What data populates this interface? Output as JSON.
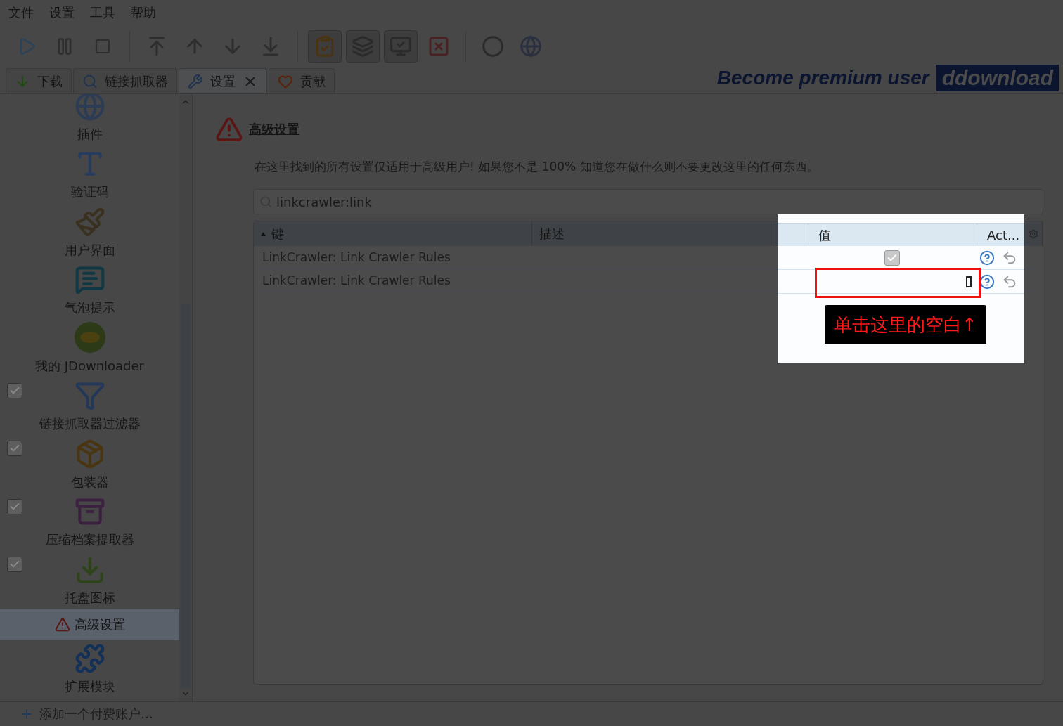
{
  "menu": [
    "文件",
    "设置",
    "工具",
    "帮助"
  ],
  "tabs": [
    {
      "label": "下载",
      "selected": false,
      "closable": false,
      "kind": "download"
    },
    {
      "label": "链接抓取器",
      "selected": false,
      "closable": false,
      "kind": "crawler"
    },
    {
      "label": "设置",
      "selected": true,
      "closable": true,
      "kind": "settings"
    },
    {
      "label": "贡献",
      "selected": false,
      "closable": false,
      "kind": "heart"
    }
  ],
  "banner": {
    "text": "Become premium user",
    "brand": "ddownload"
  },
  "sidebar": [
    {
      "label": "插件",
      "kind": "plugins",
      "toggle": false,
      "selected": false
    },
    {
      "label": "验证码",
      "kind": "captcha",
      "toggle": false,
      "selected": false
    },
    {
      "label": "用户界面",
      "kind": "ui",
      "toggle": false,
      "selected": false
    },
    {
      "label": "气泡提示",
      "kind": "bubble",
      "toggle": false,
      "selected": false
    },
    {
      "label": "我的 JDownloader",
      "kind": "my",
      "toggle": false,
      "selected": false
    },
    {
      "label": "链接抓取器过滤器",
      "kind": "filter",
      "toggle": true,
      "checked": true,
      "selected": false
    },
    {
      "label": "包装器",
      "kind": "packager",
      "toggle": true,
      "checked": true,
      "selected": false
    },
    {
      "label": "压缩档案提取器",
      "kind": "archive",
      "toggle": true,
      "checked": true,
      "selected": false
    },
    {
      "label": "托盘图标",
      "kind": "tray",
      "toggle": true,
      "checked": true,
      "selected": false
    },
    {
      "label": "高级设置",
      "kind": "advanced",
      "toggle": false,
      "selected": true
    },
    {
      "label": "扩展模块",
      "kind": "extensions",
      "toggle": false,
      "selected": false
    }
  ],
  "content": {
    "title": "高级设置",
    "description": "在这里找到的所有设置仅适用于高级用户! 如果您不是 100% 知道您在做什么则不要更改这里的任何东西。",
    "search": {
      "value": "linkcrawler:link"
    },
    "table": {
      "columns": [
        "键",
        "描述",
        "值",
        "Act..."
      ],
      "rows": [
        {
          "key": "LinkCrawler: Link Crawler Rules",
          "kind": "checkbox",
          "checked": true
        },
        {
          "key": "LinkCrawler: Link Crawler Rules",
          "kind": "text"
        }
      ]
    },
    "callout": "单击这里的空白↑"
  },
  "status_bar": {
    "text": "添加一个付费账户…"
  }
}
